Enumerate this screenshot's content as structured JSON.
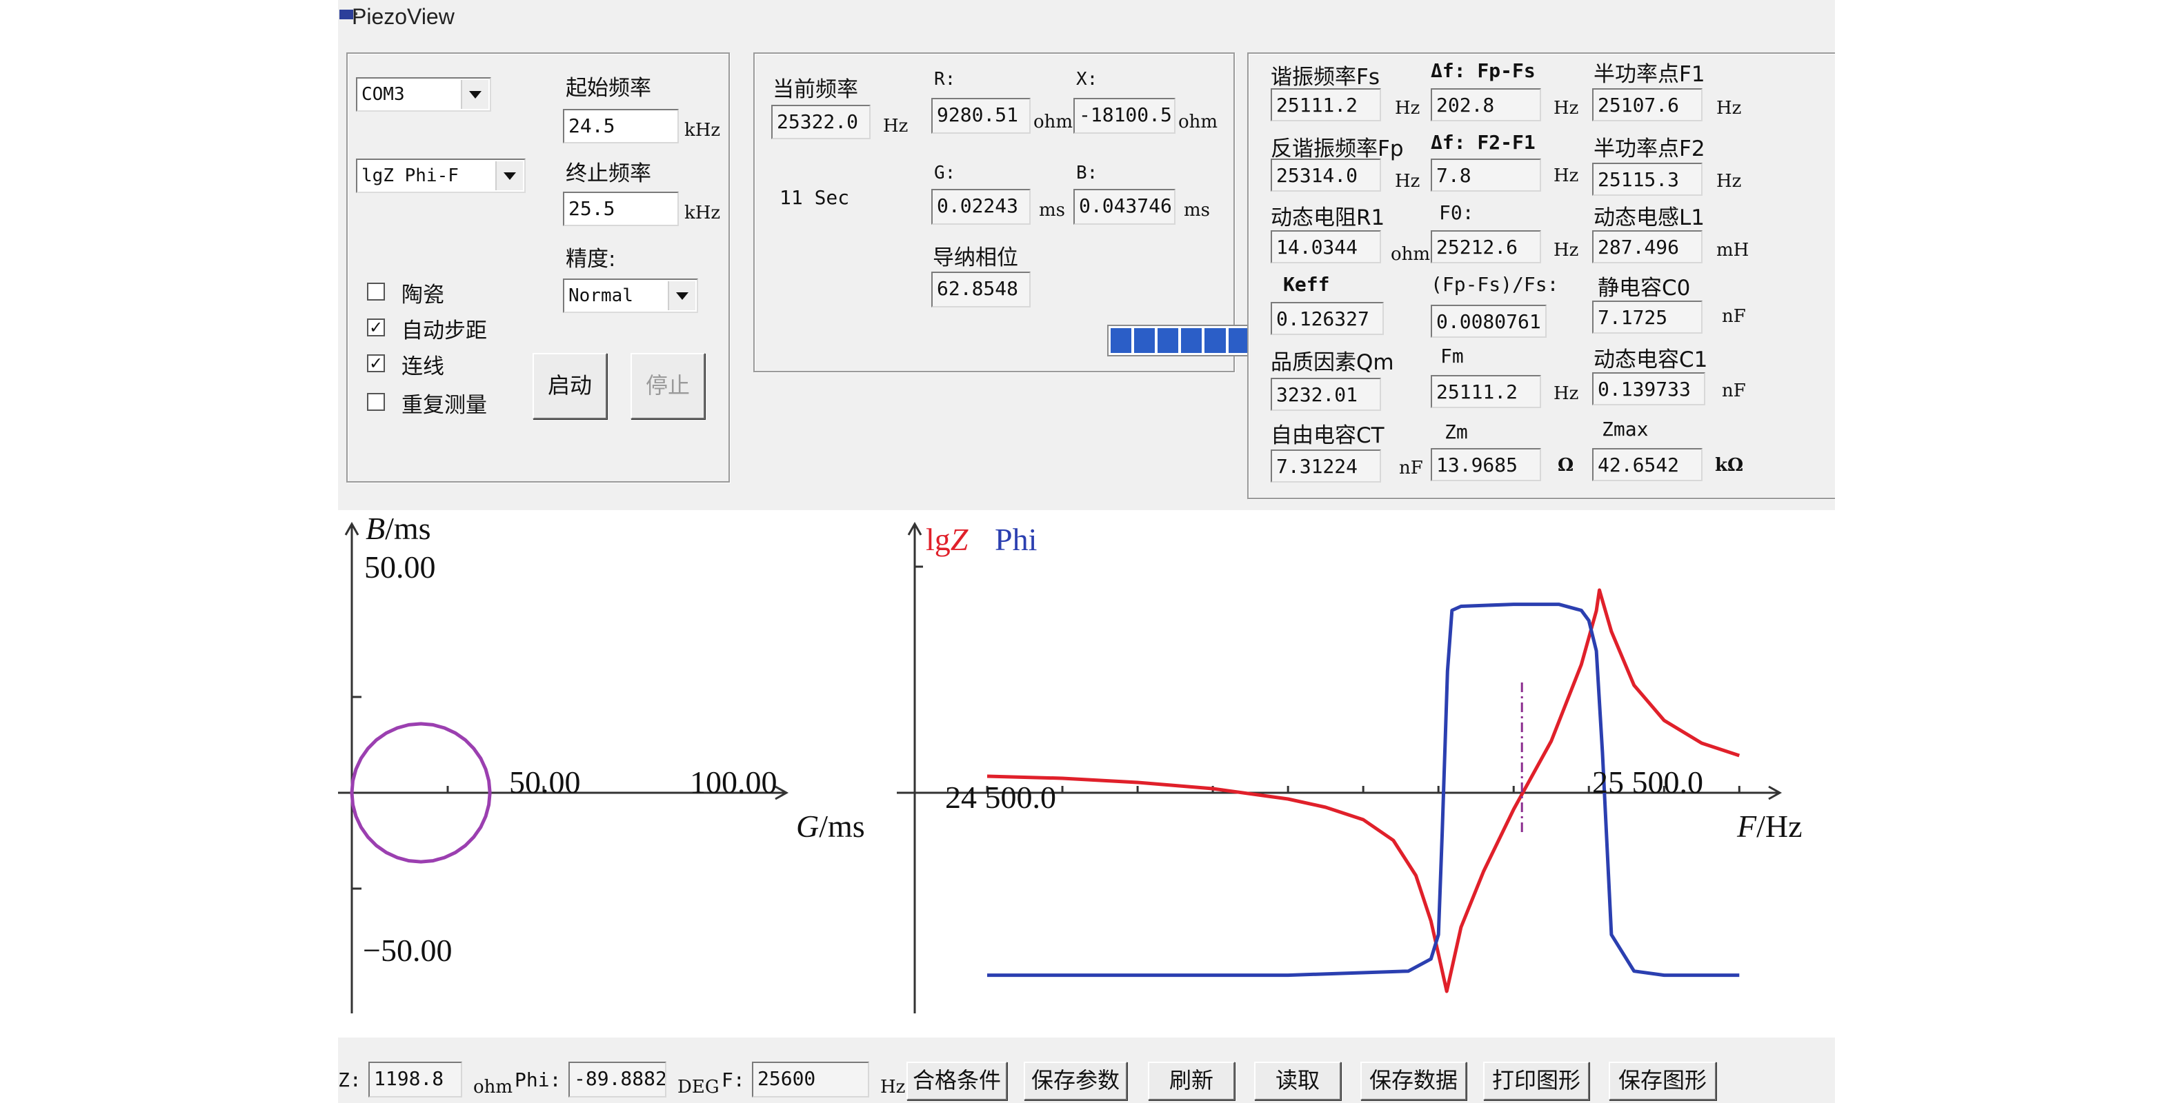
{
  "window": {
    "title": "PiezoView"
  },
  "scan": {
    "port": "COM3",
    "mode": "lgZ Phi-F",
    "start_label": "起始频率",
    "start_value": "24.5",
    "start_unit": "kHz",
    "stop_label": "终止频率",
    "stop_value": "25.5",
    "stop_unit": "kHz",
    "precision_label": "精度:",
    "precision_value": "Normal",
    "options": [
      {
        "label": "陶瓷",
        "checked": false
      },
      {
        "label": "自动步距",
        "checked": true
      },
      {
        "label": "连线",
        "checked": true
      },
      {
        "label": "重复测量",
        "checked": false
      }
    ],
    "start_button": "启动",
    "stop_button": "停止"
  },
  "current": {
    "freq_label": "当前频率",
    "freq_value": "25322.0",
    "freq_unit": "Hz",
    "r_label": "R:",
    "r_value": "9280.51",
    "r_unit": "ohm",
    "x_label": "X:",
    "x_value": "-18100.5",
    "x_unit": "ohm",
    "time_label": "11 Sec",
    "g_label": "G:",
    "g_value": "0.02243",
    "g_unit": "ms",
    "b_label": "B:",
    "b_value": "0.043746",
    "b_unit": "ms",
    "phase_label": "导纳相位",
    "phase_value": "62.8548",
    "progress_fraction": 1.0
  },
  "params": {
    "fs_label": "谐振频率Fs",
    "fs_value": "25111.2",
    "fs_unit": "Hz",
    "dffs_label": "Δf: Fp-Fs",
    "dffs_value": "202.8",
    "dffs_unit": "Hz",
    "f1_label": "半功率点F1",
    "f1_value": "25107.6",
    "f1_unit": "Hz",
    "fp_label": "反谐振频率Fp",
    "fp_value": "25314.0",
    "fp_unit": "Hz",
    "df21_label": "Δf: F2-F1",
    "df21_value": "7.8",
    "df21_unit": "Hz",
    "f2_label": "半功率点F2",
    "f2_value": "25115.3",
    "f2_unit": "Hz",
    "r1_label": "动态电阻R1",
    "r1_value": "14.0344",
    "r1_unit": "ohm",
    "f0_label": "F0:",
    "f0_value": "25212.6",
    "f0_unit": "Hz",
    "l1_label": "动态电感L1",
    "l1_value": "287.496",
    "l1_unit": "mH",
    "keff_label": "Keff",
    "keff_value": "0.126327",
    "fpfs_label": "(Fp-Fs)/Fs:",
    "fpfs_value": "0.0080761:",
    "c0_label": "静电容C0",
    "c0_value": "7.1725",
    "c0_unit": "nF",
    "qm_label": "品质因素Qm",
    "qm_value": "3232.01",
    "fm_label": "Fm",
    "fm_value": "25111.2",
    "fm_unit": "Hz",
    "c1_label": "动态电容C1",
    "c1_value": "0.139733",
    "c1_unit": "nF",
    "ct_label": "自由电容CT",
    "ct_value": "7.31224",
    "ct_unit": "nF",
    "zm_label": "Zm",
    "zm_value": "13.9685",
    "zm_unit": "Ω",
    "zmax_label": "Zmax",
    "zmax_value": "42.6542",
    "zmax_unit": "kΩ"
  },
  "status": {
    "z_label": "Z:",
    "z_value": "1198.8",
    "z_unit": "ohm",
    "phi_label": "Phi:",
    "phi_value": "-89.8882",
    "phi_unit": "DEG",
    "f_label": "F:",
    "f_value": "25600",
    "f_unit": "Hz"
  },
  "toolbar": [
    "合格条件",
    "保存参数",
    "刷新",
    "读取",
    "保存数据",
    "打印图形",
    "保存图形"
  ],
  "colors": {
    "circle": "#9b3fb0",
    "lgz": "#e0202a",
    "phi": "#2b3fb0",
    "progress": "#2b5ec7",
    "led": "#2fbf2f"
  },
  "chart_data": [
    {
      "type": "line",
      "name_hint": "admittance circle",
      "ylabel_prefix": "B",
      "ylabel_unit": "/ms",
      "xlabel_prefix": "G",
      "xlabel_unit": "/ms",
      "xticks": [
        "50.00",
        "100.00"
      ],
      "yticks": [
        "50.00",
        "−50.00"
      ],
      "xlim": [
        0,
        135
      ],
      "ylim": [
        -60,
        60
      ],
      "circle": {
        "center_g": 36,
        "center_b": 0,
        "radius": 36
      }
    },
    {
      "type": "line",
      "legend": [
        "lgZ",
        "Phi"
      ],
      "xlabel": "F/Hz",
      "xticks": [
        "24 500.0",
        "25 500.0"
      ],
      "xlim": [
        24400,
        25600
      ],
      "markers": [
        {
          "x": 25211,
          "style": "dash-dot"
        }
      ],
      "series": [
        {
          "name": "lgZ",
          "x": [
            24500,
            24600,
            24700,
            24800,
            24900,
            24950,
            25000,
            25040,
            25070,
            25090,
            25100,
            25111,
            25130,
            25160,
            25200,
            25250,
            25290,
            25310,
            25314,
            25330,
            25360,
            25400,
            25450,
            25500
          ],
          "values": [
            0.08,
            0.07,
            0.05,
            0.02,
            -0.03,
            -0.07,
            -0.13,
            -0.23,
            -0.4,
            -0.62,
            -0.78,
            -0.96,
            -0.65,
            -0.38,
            -0.08,
            0.25,
            0.62,
            0.88,
            0.98,
            0.78,
            0.52,
            0.35,
            0.24,
            0.18
          ]
        },
        {
          "name": "Phi",
          "x": [
            24500,
            24900,
            25060,
            25090,
            25100,
            25105,
            25112,
            25118,
            25130,
            25200,
            25260,
            25290,
            25300,
            25310,
            25318,
            25330,
            25360,
            25400,
            25450,
            25500
          ],
          "values": [
            -0.9,
            -0.9,
            -0.88,
            -0.82,
            -0.7,
            -0.2,
            0.6,
            0.9,
            0.92,
            0.93,
            0.93,
            0.9,
            0.85,
            0.7,
            0.2,
            -0.7,
            -0.88,
            -0.9,
            -0.9,
            -0.9
          ]
        }
      ]
    }
  ]
}
